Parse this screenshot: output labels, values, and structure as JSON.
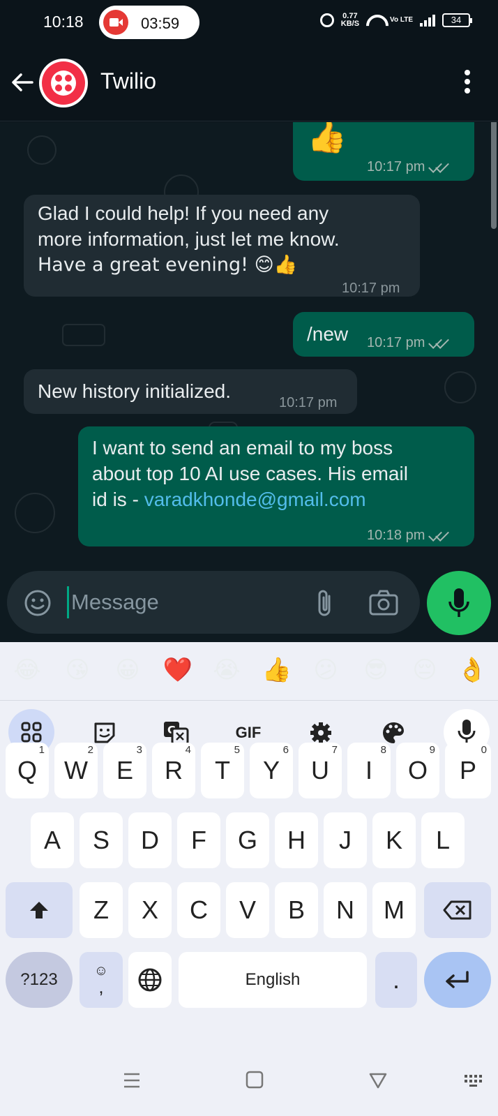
{
  "status_bar": {
    "time": "10:18",
    "recording_time": "03:59",
    "net_speed_value": "0.77",
    "net_speed_unit": "KB/S",
    "volte": "Vo LTE",
    "battery": "34"
  },
  "header": {
    "contact_name": "Twilio"
  },
  "messages": [
    {
      "direction": "out",
      "text": "👍",
      "time": "10:17 pm",
      "read": true
    },
    {
      "direction": "in",
      "lines": [
        "Glad I could help! If you need any",
        "more information, just let me know.",
        "Have a great evening! 😊👍"
      ],
      "time": "10:17 pm"
    },
    {
      "direction": "out",
      "text": "/new",
      "time": "10:17 pm",
      "read": true
    },
    {
      "direction": "in",
      "text": "New history initialized.",
      "time": "10:17 pm"
    },
    {
      "direction": "out",
      "lines": [
        "I want to send an email to my boss",
        "about top 10 AI use cases. His email"
      ],
      "prefix": "id is - ",
      "link": "varadkhonde@gmail.com",
      "time": "10:18 pm",
      "read": true
    }
  ],
  "composer": {
    "placeholder": "Message"
  },
  "keyboard": {
    "suggested_emojis": [
      "😂",
      "😘",
      "😀",
      "❤️",
      "😭",
      "👍",
      "😕",
      "😎",
      "😔",
      "👌"
    ],
    "tools": {
      "gif": "GIF"
    },
    "row1": [
      "Q",
      "W",
      "E",
      "R",
      "T",
      "Y",
      "U",
      "I",
      "O",
      "P"
    ],
    "row1_hints": [
      "1",
      "2",
      "3",
      "4",
      "5",
      "6",
      "7",
      "8",
      "9",
      "0"
    ],
    "row2": [
      "A",
      "S",
      "D",
      "F",
      "G",
      "H",
      "J",
      "K",
      "L"
    ],
    "row3": [
      "Z",
      "X",
      "C",
      "V",
      "B",
      "N",
      "M"
    ],
    "symbols_key": "?123",
    "comma_key": ",",
    "space_label": "English",
    "period_key": "."
  }
}
